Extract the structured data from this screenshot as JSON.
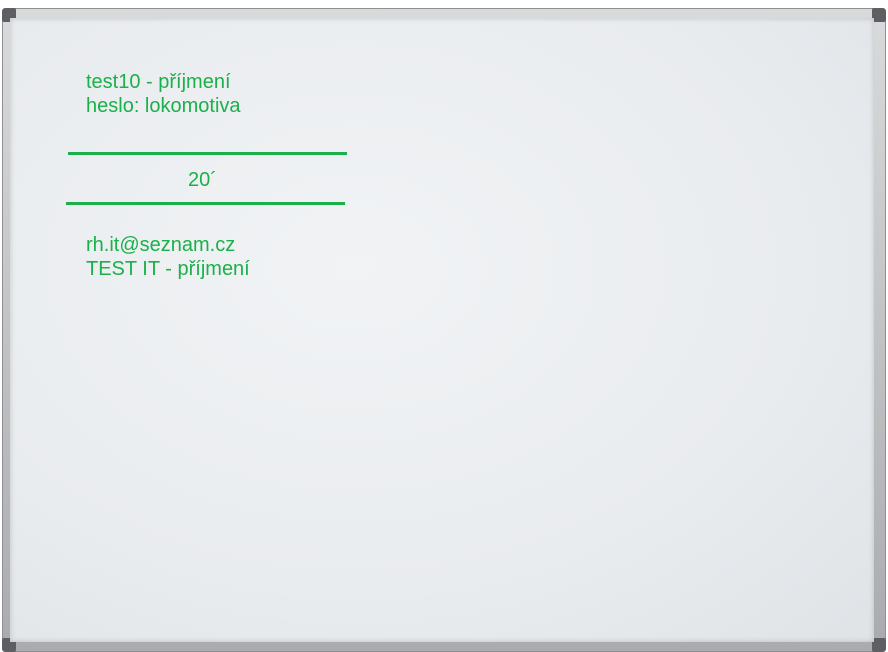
{
  "colors": {
    "ink": "#1bb04a",
    "frame": "#b4b6b9",
    "corner": "#5d5f63",
    "surface": "#e9ecef"
  },
  "board": {
    "line1": "test10 - příjmení",
    "line2": "heslo: lokomotiva",
    "time": "20´",
    "email": "rh.it@seznam.cz",
    "subject": "TEST IT - příjmení"
  }
}
